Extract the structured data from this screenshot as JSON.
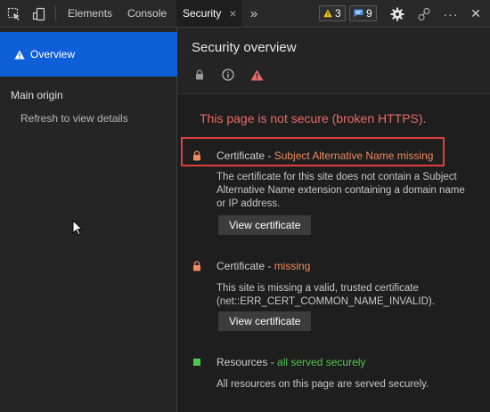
{
  "toolbar": {
    "tabs": [
      {
        "label": "Elements"
      },
      {
        "label": "Console"
      },
      {
        "label": "Security",
        "close": "×"
      }
    ],
    "more_tabs": "»",
    "warnings_count": "3",
    "messages_count": "9",
    "more_menu": "···",
    "close": "✕"
  },
  "sidebar": {
    "overview_label": "Overview",
    "main_origin_label": "Main origin",
    "refresh_label": "Refresh to view details"
  },
  "main": {
    "title": "Security overview",
    "banner": "This page is not secure (broken HTTPS).",
    "entries": [
      {
        "title_prefix": "Certificate - ",
        "title_status": "Subject Alternative Name missing",
        "description": "The certificate for this site does not contain a Subject Alternative Name extension containing a domain name or IP address.",
        "button_label": "View certificate"
      },
      {
        "title_prefix": "Certificate - ",
        "title_status": "missing",
        "description": "This site is missing a valid, trusted certificate (net::ERR_CERT_COMMON_NAME_INVALID).",
        "button_label": "View certificate"
      },
      {
        "title_prefix": "Resources - ",
        "title_status": "all served securely",
        "description": "All resources on this page are served securely."
      }
    ]
  },
  "colors": {
    "accent": "#0f5fd9",
    "danger": "#ea6a6a",
    "warning_orange": "#f08a5d",
    "secure_green": "#4ec94e",
    "highlight_box": "#e0403c"
  },
  "icons": [
    "inspect-element-icon",
    "device-toolbar-icon",
    "warning-icon",
    "message-icon",
    "gear-icon",
    "connection-icon",
    "lock-icon",
    "info-icon",
    "security-warning-icon",
    "mouse-pointer-icon"
  ]
}
